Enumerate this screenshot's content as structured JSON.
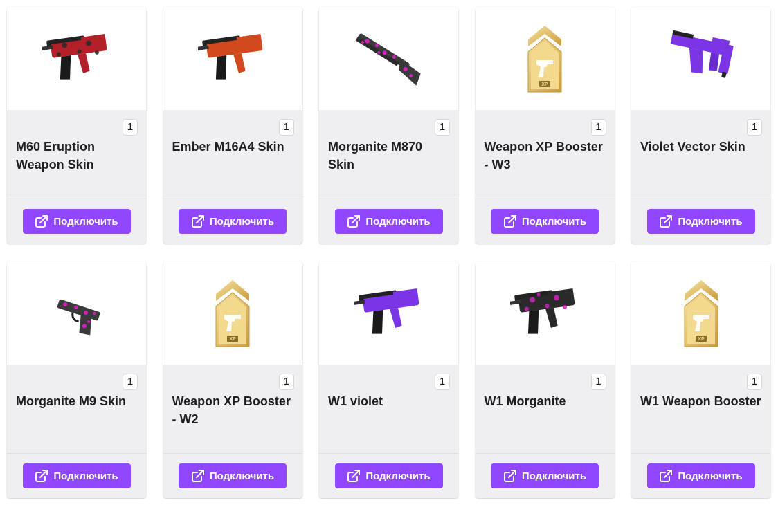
{
  "items": [
    {
      "title": "M60 Eruption Weapon Skin",
      "quantity": "1",
      "button_label": "Подключить",
      "image": "rifle-red-camo",
      "colors": [
        "#b3202a",
        "#2a2a2a"
      ]
    },
    {
      "title": "Ember M16A4 Skin",
      "quantity": "1",
      "button_label": "Подключить",
      "image": "rifle-orange",
      "colors": [
        "#d04a1e",
        "#1a1a1a"
      ]
    },
    {
      "title": "Morganite M870 Skin",
      "quantity": "1",
      "button_label": "Подключить",
      "image": "shotgun-pink-camo",
      "colors": [
        "#d61fc1",
        "#3a3a3a"
      ]
    },
    {
      "title": "Weapon XP Booster - W3",
      "quantity": "1",
      "button_label": "Подключить",
      "image": "xp-booster-badge",
      "colors": [
        "#d9b24a",
        "#f3d98a"
      ]
    },
    {
      "title": "Violet Vector Skin",
      "quantity": "1",
      "button_label": "Подключить",
      "image": "smg-violet",
      "colors": [
        "#7b35e6",
        "#1a1a1a"
      ]
    },
    {
      "title": "Morganite M9 Skin",
      "quantity": "1",
      "button_label": "Подключить",
      "image": "pistol-pink-camo",
      "colors": [
        "#d61fc1",
        "#3a3a3a"
      ]
    },
    {
      "title": "Weapon XP Booster - W2",
      "quantity": "1",
      "button_label": "Подключить",
      "image": "xp-booster-badge",
      "colors": [
        "#d9b24a",
        "#f3d98a"
      ]
    },
    {
      "title": "W1 violet",
      "quantity": "1",
      "button_label": "Подключить",
      "image": "rifle-violet",
      "colors": [
        "#7b35e6",
        "#1a1a1a"
      ]
    },
    {
      "title": "W1 Morganite",
      "quantity": "1",
      "button_label": "Подключить",
      "image": "rifle-pink-camo",
      "colors": [
        "#d61fc1",
        "#2a2a2a"
      ]
    },
    {
      "title": "W1 Weapon Booster",
      "quantity": "1",
      "button_label": "Подключить",
      "image": "xp-booster-badge",
      "colors": [
        "#d9b24a",
        "#f3d98a"
      ]
    }
  ],
  "xp_badge_text": "XP",
  "theme": {
    "accent": "#9147ff",
    "card_bg": "#efeff1"
  }
}
